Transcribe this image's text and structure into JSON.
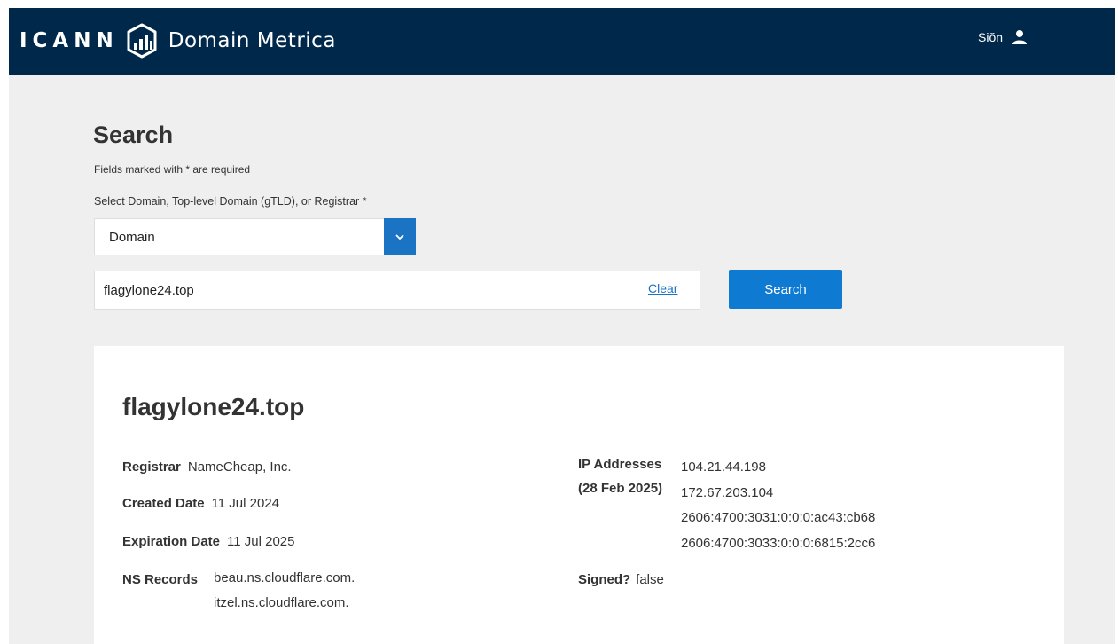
{
  "header": {
    "brand_main": "ICANN",
    "brand_product": "Domain Metrica",
    "signin_label": "Siŏn",
    "logo_icon": "icann-bar-chart-logo-icon",
    "user_icon": "user-icon",
    "background_color": "#00284a"
  },
  "search": {
    "title": "Search",
    "required_note": "Fields marked with * are required",
    "select_label": "Select Domain, Top-level Domain (gTLD), or Registrar *",
    "select_value": "Domain",
    "input_value": "flagylone24.top",
    "clear_label": "Clear",
    "search_button_label": "Search",
    "accent_color": "#0f7ad1"
  },
  "result": {
    "domain": "flagylone24.top",
    "registrar_label": "Registrar",
    "registrar_value": "NameCheap, Inc.",
    "created_label": "Created Date",
    "created_value": "11 Jul 2024",
    "expiration_label": "Expiration Date",
    "expiration_value": "11 Jul 2025",
    "ns_label": "NS Records",
    "ns_records": [
      "beau.ns.cloudflare.com.",
      "itzel.ns.cloudflare.com."
    ],
    "ip_label_line1": "IP Addresses",
    "ip_label_line2": "(28 Feb 2025)",
    "ip_addresses": [
      "104.21.44.198",
      "172.67.203.104",
      "2606:4700:3031:0:0:0:ac43:cb68",
      "2606:4700:3033:0:0:0:6815:2cc6"
    ],
    "signed_label": "Signed?",
    "signed_value": "false"
  }
}
